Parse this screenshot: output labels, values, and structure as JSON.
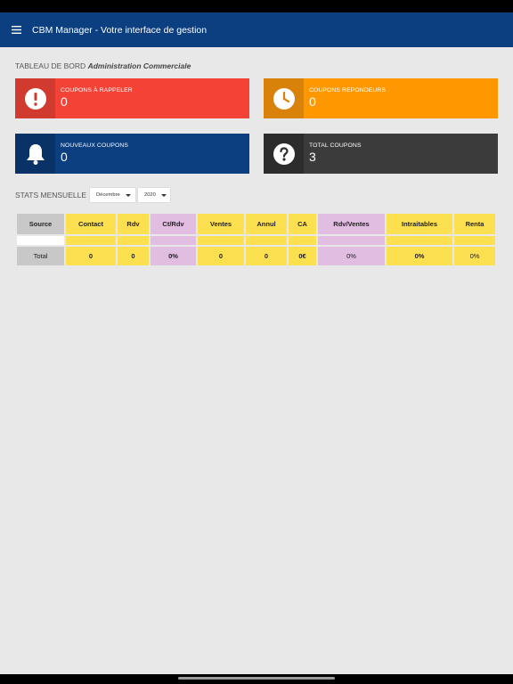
{
  "app": {
    "title": "CBM Manager - Votre interface de gestion"
  },
  "dashboard": {
    "heading_prefix": "TABLEAU DE BORD",
    "heading_bold": "Administration Commerciale"
  },
  "cards": [
    {
      "label": "COUPONS À RAPPELER",
      "value": "0",
      "icon": "exclamation-icon",
      "color": "#f44336"
    },
    {
      "label": "COUPONS REPONDEURS",
      "value": "0",
      "icon": "clock-icon",
      "color": "#ff9800"
    },
    {
      "label": "NOUVEAUX COUPONS",
      "value": "0",
      "icon": "bell-icon",
      "color": "#0b3f80"
    },
    {
      "label": "TOTAL COUPONS",
      "value": "3",
      "icon": "question-icon",
      "color": "#3b3b3b"
    }
  ],
  "stats": {
    "label": "STATS MENSUELLE",
    "month": "Décembre",
    "year": "2020",
    "headers": [
      "Source",
      "Contact",
      "Rdv",
      "Ct/Rdv",
      "Ventes",
      "Annul",
      "CA",
      "Rdv/Ventes",
      "Intraitables",
      "Renta"
    ],
    "total_row": [
      "Total",
      "0",
      "0",
      "0%",
      "0",
      "0",
      "0€",
      "0%",
      "0%",
      "0%"
    ]
  }
}
